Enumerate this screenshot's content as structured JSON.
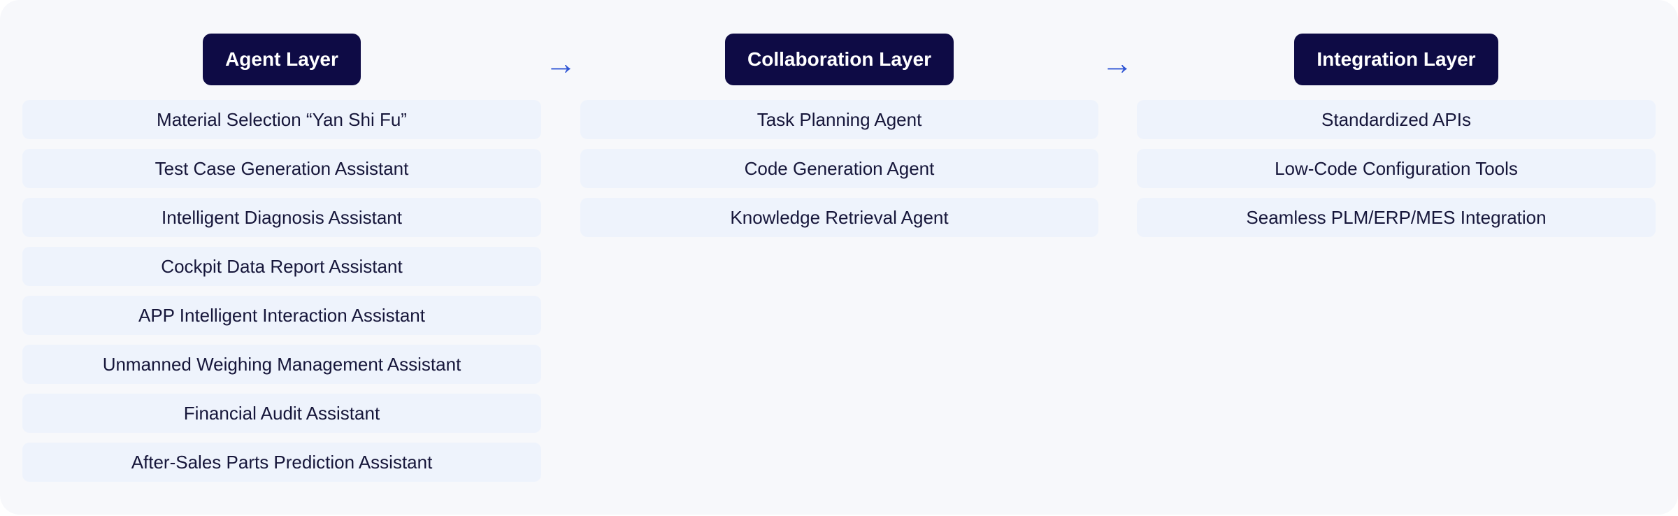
{
  "layers": [
    {
      "title": "Agent Layer",
      "items": [
        "Material Selection “Yan Shi Fu”",
        "Test Case Generation Assistant",
        "Intelligent Diagnosis Assistant",
        "Cockpit Data Report Assistant",
        "APP Intelligent Interaction Assistant",
        "Unmanned Weighing Management Assistant",
        "Financial Audit Assistant",
        "After-Sales Parts Prediction Assistant"
      ]
    },
    {
      "title": "Collaboration Layer",
      "items": [
        "Task Planning Agent",
        "Code Generation Agent",
        "Knowledge Retrieval Agent"
      ]
    },
    {
      "title": "Integration Layer",
      "items": [
        "Standardized APIs",
        "Low-Code Configuration Tools",
        "Seamless PLM/ERP/MES Integration"
      ]
    }
  ],
  "arrows": [
    "→",
    "→"
  ],
  "colors": {
    "header_bg": "#0e0b45",
    "item_bg": "#eef3fc",
    "arrow": "#2f55d4",
    "canvas_bg": "#f7f8fb"
  }
}
